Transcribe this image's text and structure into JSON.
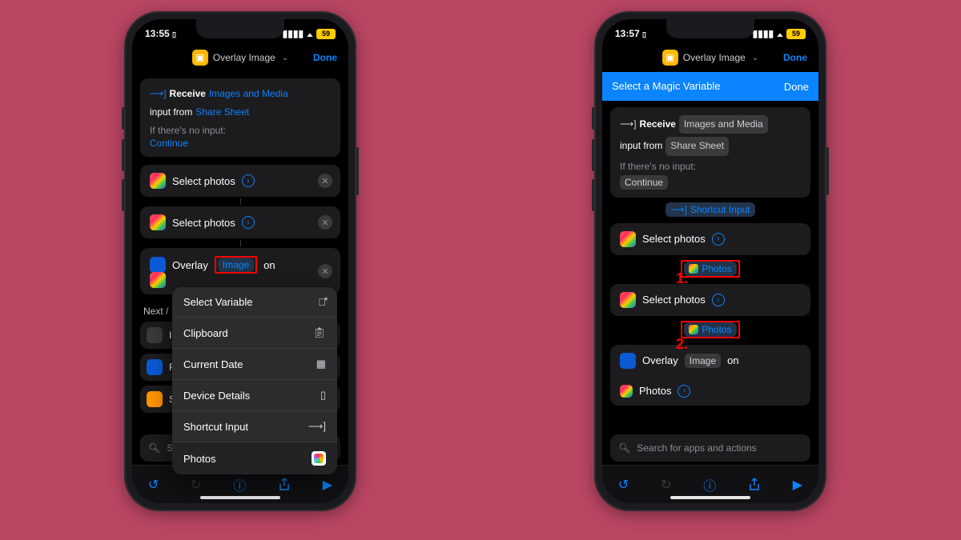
{
  "left": {
    "status": {
      "time": "13:55",
      "battery": "59"
    },
    "header": {
      "title": "Overlay Image",
      "done": "Done"
    },
    "receive": {
      "receive": "Receive",
      "types": "Images and Media",
      "inputFrom": "input from",
      "source": "Share Sheet",
      "noInput": "If there's no input:",
      "fallback": "Continue"
    },
    "selectPhotos": "Select photos",
    "overlay": {
      "word": "Overlay",
      "token": "Image",
      "on": "on"
    },
    "nextHeader": "Next /",
    "popup": {
      "selectVariable": "Select Variable",
      "clipboard": "Clipboard",
      "currentDate": "Current Date",
      "deviceDetails": "Device Details",
      "shortcutInput": "Shortcut Input",
      "photos": "Photos"
    },
    "search": "Se"
  },
  "right": {
    "status": {
      "time": "13:57",
      "battery": "59"
    },
    "header": {
      "title": "Overlay Image",
      "done": "Done"
    },
    "banner": {
      "title": "Select a Magic Variable",
      "done": "Done"
    },
    "receive": {
      "receive": "Receive",
      "types": "Images and Media",
      "inputFrom": "input from",
      "source": "Share Sheet",
      "noInput": "If there's no input:",
      "fallback": "Continue"
    },
    "shortcutInputChip": "Shortcut Input",
    "selectPhotos": "Select photos",
    "photosChip": "Photos",
    "overlay": {
      "word": "Overlay",
      "token": "Image",
      "on": "on",
      "photos": "Photos"
    },
    "num1": "1.",
    "num2": "2.",
    "search": "Search for apps and actions"
  }
}
